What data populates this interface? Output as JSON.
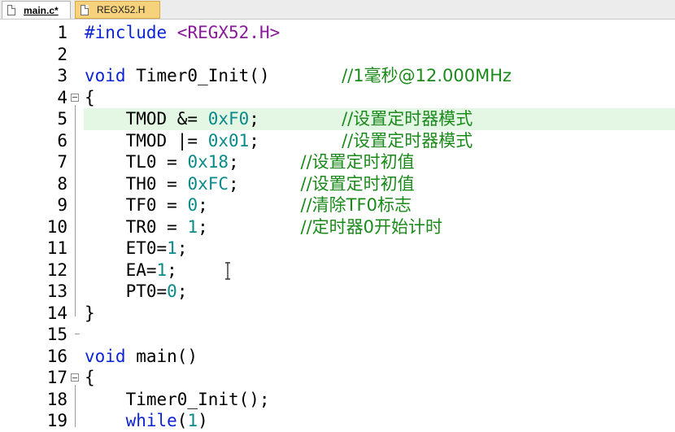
{
  "tabs": [
    {
      "label": "main.c*",
      "icon": "file-icon",
      "active": true
    },
    {
      "label": "REGX52.H",
      "icon": "file-icon",
      "active": false
    }
  ],
  "colors": {
    "keyword": "#0b24d6",
    "number": "#0a8a8a",
    "comment": "#1a8a1a",
    "string": "#8a1a9b",
    "highlight": "#e4f6e4",
    "tab_inactive": "#f7d27c"
  },
  "editor": {
    "highlighted_line": 5,
    "lines": [
      {
        "n": "1",
        "tokens": [
          [
            "pre",
            "#include "
          ],
          [
            "str",
            "<REGX52.H>"
          ]
        ]
      },
      {
        "n": "2",
        "tokens": []
      },
      {
        "n": "3",
        "tokens": [
          [
            "kw",
            "void"
          ],
          [
            "txt",
            " Timer0_Init()       "
          ],
          [
            "cmt",
            "//1毫秒@12.000MHz"
          ]
        ]
      },
      {
        "n": "4",
        "tokens": [
          [
            "txt",
            "{"
          ]
        ]
      },
      {
        "n": "5",
        "tokens": [
          [
            "txt",
            "    TMOD &= "
          ],
          [
            "num",
            "0xF0"
          ],
          [
            "txt",
            ";        "
          ],
          [
            "cmt",
            "//设置定时器模式"
          ]
        ]
      },
      {
        "n": "6",
        "tokens": [
          [
            "txt",
            "    TMOD |= "
          ],
          [
            "num",
            "0x01"
          ],
          [
            "txt",
            ";        "
          ],
          [
            "cmt",
            "//设置定时器模式"
          ]
        ]
      },
      {
        "n": "7",
        "tokens": [
          [
            "txt",
            "    TL0 = "
          ],
          [
            "num",
            "0x18"
          ],
          [
            "txt",
            ";      "
          ],
          [
            "cmt",
            "//设置定时初值"
          ]
        ]
      },
      {
        "n": "8",
        "tokens": [
          [
            "txt",
            "    TH0 = "
          ],
          [
            "num",
            "0xFC"
          ],
          [
            "txt",
            ";      "
          ],
          [
            "cmt",
            "//设置定时初值"
          ]
        ]
      },
      {
        "n": "9",
        "tokens": [
          [
            "txt",
            "    TF0 = "
          ],
          [
            "num",
            "0"
          ],
          [
            "txt",
            ";         "
          ],
          [
            "cmt",
            "//清除TF0标志"
          ]
        ]
      },
      {
        "n": "10",
        "tokens": [
          [
            "txt",
            "    TR0 = "
          ],
          [
            "num",
            "1"
          ],
          [
            "txt",
            ";         "
          ],
          [
            "cmt",
            "//定时器0开始计时"
          ]
        ]
      },
      {
        "n": "11",
        "tokens": [
          [
            "txt",
            "    ET0="
          ],
          [
            "num",
            "1"
          ],
          [
            "txt",
            ";"
          ]
        ]
      },
      {
        "n": "12",
        "tokens": [
          [
            "txt",
            "    EA="
          ],
          [
            "num",
            "1"
          ],
          [
            "txt",
            ";"
          ]
        ]
      },
      {
        "n": "13",
        "tokens": [
          [
            "txt",
            "    PT0="
          ],
          [
            "num",
            "0"
          ],
          [
            "txt",
            ";"
          ]
        ]
      },
      {
        "n": "14",
        "tokens": [
          [
            "txt",
            "}"
          ]
        ]
      },
      {
        "n": "15",
        "tokens": []
      },
      {
        "n": "16",
        "tokens": [
          [
            "kw",
            "void"
          ],
          [
            "txt",
            " main()"
          ]
        ]
      },
      {
        "n": "17",
        "tokens": [
          [
            "txt",
            "{"
          ]
        ]
      },
      {
        "n": "18",
        "tokens": [
          [
            "txt",
            "    Timer0_Init();"
          ]
        ]
      },
      {
        "n": "19",
        "tokens": [
          [
            "txt",
            "    "
          ],
          [
            "kw",
            "while"
          ],
          [
            "txt",
            "("
          ],
          [
            "num",
            "1"
          ],
          [
            "txt",
            ")"
          ]
        ]
      }
    ]
  }
}
